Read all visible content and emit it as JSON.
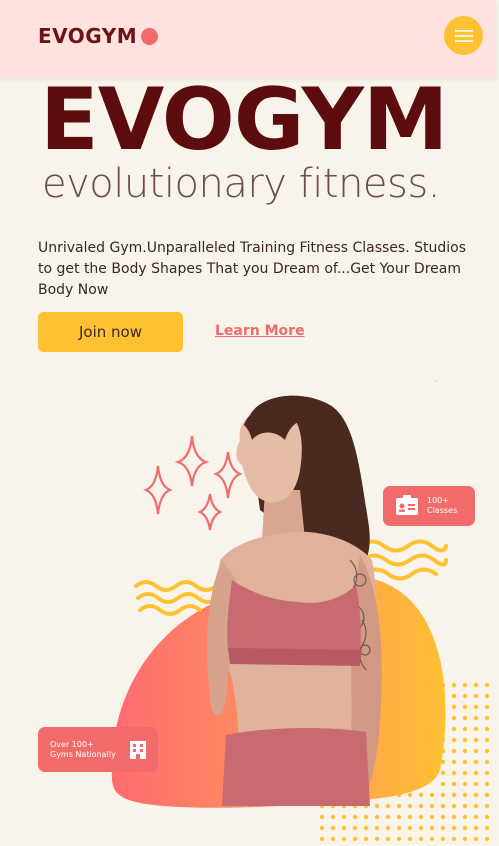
{
  "navbar": {
    "logo_text": "EVOGYM",
    "menu_icon": "hamburger-icon"
  },
  "hero": {
    "title": "EVOGYM",
    "subtitle": "evolutionary fitness.",
    "description": "Unrivaled Gym.Unparalleled Training Fitness Classes. Studios to get the Body Shapes That you Dream of...Get Your Dream Body Now",
    "join_label": "Join now",
    "learn_label": "Learn More"
  },
  "badges": {
    "classes": {
      "line1": "100+",
      "line2": "Classes",
      "icon": "id-card-icon"
    },
    "gyms": {
      "line1": "Over 100+",
      "line2": "Gyms Nationally",
      "icon": "building-icon"
    }
  },
  "colors": {
    "accent_yellow": "#FFC132",
    "accent_coral": "#F26B6B",
    "navbar_bg": "#FFE1E0",
    "title": "#5C0C0C",
    "page_bg": "#F8F4EC"
  }
}
